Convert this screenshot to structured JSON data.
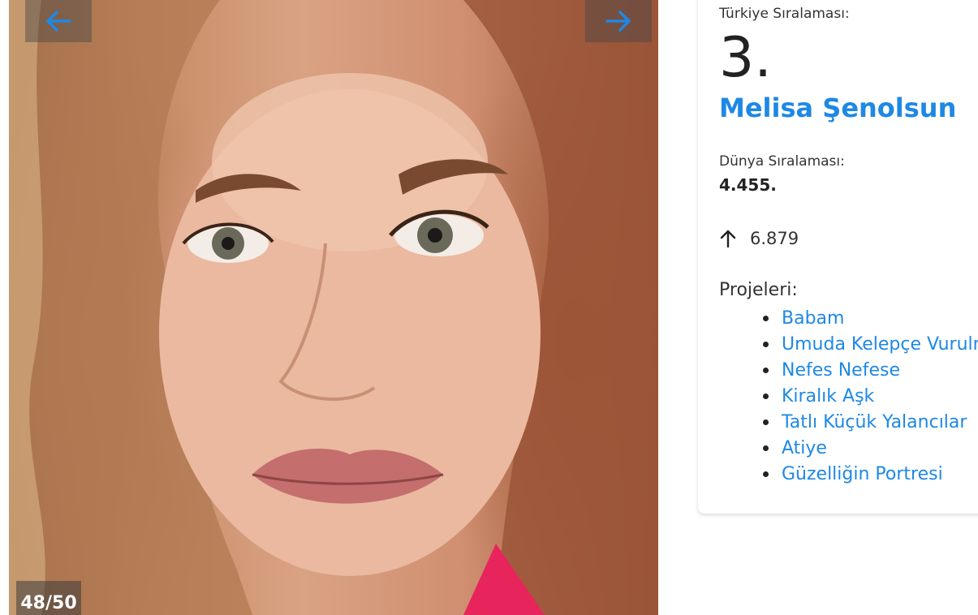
{
  "gallery": {
    "counter": "48/50",
    "prev_icon": "arrow-left-icon",
    "next_icon": "arrow-right-icon"
  },
  "info": {
    "turkey_rank_label": "Türkiye Sıralaması:",
    "turkey_rank": "3.",
    "name": "Melisa Şenolsun",
    "world_rank_label": "Dünya Sıralaması:",
    "world_rank": "4.455.",
    "change_icon": "arrow-up-icon",
    "change_value": "6.879",
    "projects_label": "Projeleri:",
    "projects": [
      "Babam",
      "Umuda Kelepçe Vurulmaz",
      "Nefes Nefese",
      "Kiralık Aşk",
      "Tatlı Küçük Yalancılar",
      "Atiye",
      "Güzelliğin Portresi"
    ]
  },
  "colors": {
    "link": "#1e88e5",
    "text": "#222222"
  }
}
